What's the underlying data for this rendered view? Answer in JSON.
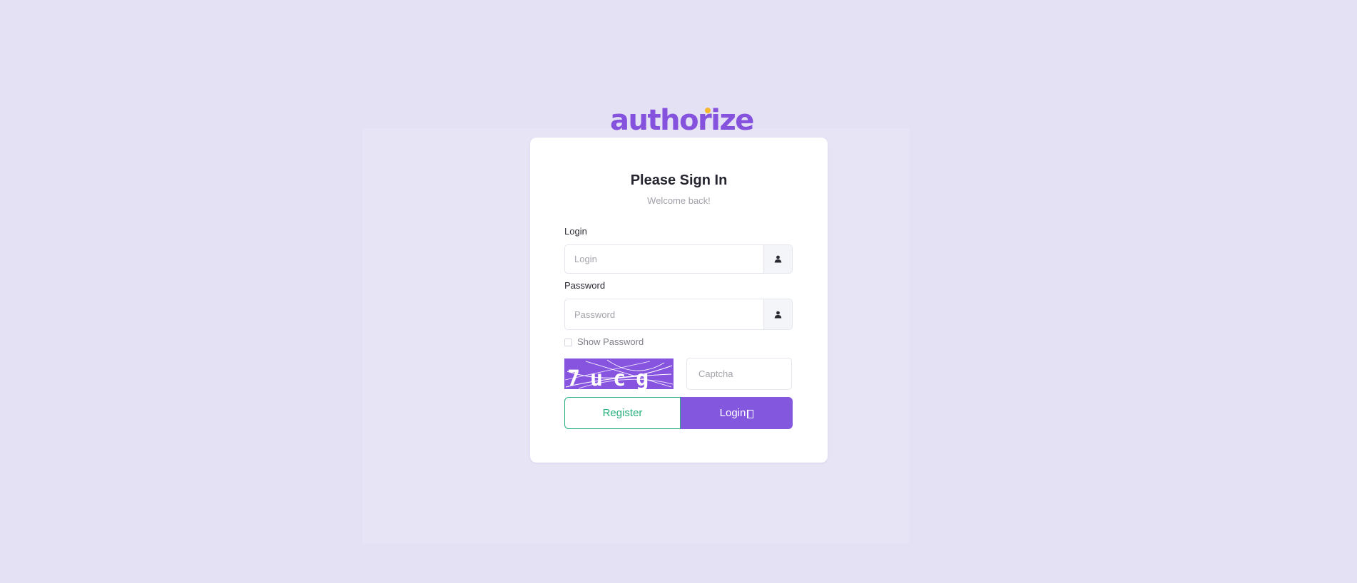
{
  "brand": {
    "logo_text": "authorize",
    "accent_color": "#8452dd",
    "dot_color": "#f5b82e"
  },
  "card": {
    "title": "Please Sign In",
    "subtitle": "Welcome back!"
  },
  "login_field": {
    "label": "Login",
    "placeholder": "Login",
    "value": "",
    "addon_icon": "user-icon"
  },
  "password_field": {
    "label": "Password",
    "placeholder": "Password",
    "value": "",
    "addon_icon": "user-icon"
  },
  "show_password": {
    "label": "Show Password",
    "checked": false
  },
  "captcha": {
    "image_text": "7ucg",
    "placeholder": "Captcha",
    "value": ""
  },
  "buttons": {
    "register_label": "Register",
    "login_label": "Login",
    "login_icon": "door-enter-icon",
    "register_color": "#25b07c",
    "login_color": "#8457df"
  }
}
